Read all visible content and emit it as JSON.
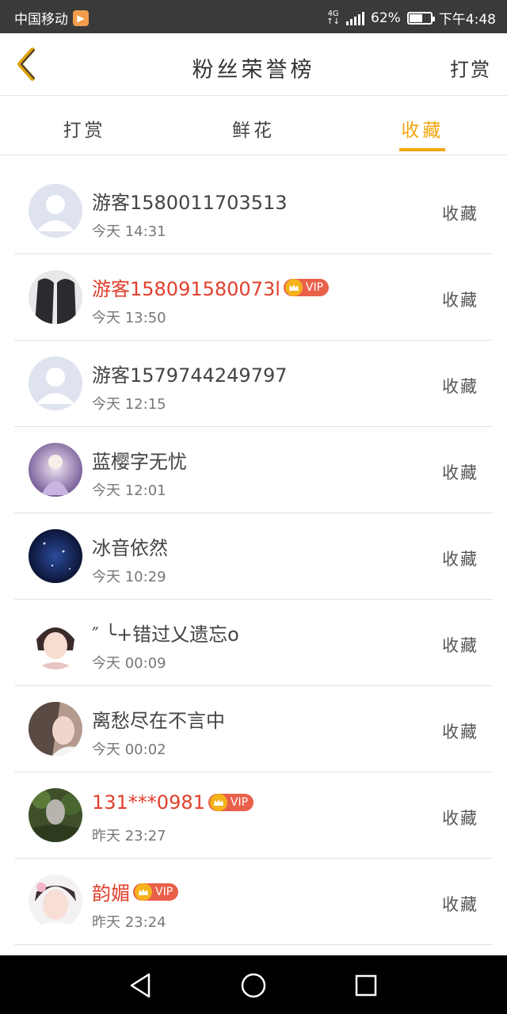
{
  "status_bar": {
    "carrier": "中国移动",
    "network": "4G",
    "battery": "62%",
    "battery_level": 0.62,
    "time": "下午4:48"
  },
  "header": {
    "title": "粉丝荣誉榜",
    "action": "打赏"
  },
  "tabs": [
    {
      "label": "打赏",
      "active": false
    },
    {
      "label": "鲜花",
      "active": false
    },
    {
      "label": "收藏",
      "active": true
    }
  ],
  "fans": [
    {
      "name": "游客1580011703513",
      "time": "今天 14:31",
      "action": "收藏",
      "vip": false
    },
    {
      "name": "游客158091580073l",
      "time": "今天 13:50",
      "action": "收藏",
      "vip": true,
      "vip_label": "VIP"
    },
    {
      "name": "游客1579744249797",
      "time": "今天 12:15",
      "action": "收藏",
      "vip": false
    },
    {
      "name": "蓝樱字无忧",
      "time": "今天 12:01",
      "action": "收藏",
      "vip": false
    },
    {
      "name": "冰音依然",
      "time": "今天 10:29",
      "action": "收藏",
      "vip": false
    },
    {
      "name": "″ ╰+错过乂遗忘o",
      "time": "今天 00:09",
      "action": "收藏",
      "vip": false
    },
    {
      "name": "离愁尽在不言中",
      "time": "今天 00:02",
      "action": "收藏",
      "vip": false
    },
    {
      "name": "131***0981",
      "time": "昨天 23:27",
      "action": "收藏",
      "vip": true,
      "vip_label": "VIP"
    },
    {
      "name": "韵媚",
      "time": "昨天 23:24",
      "action": "收藏",
      "vip": true,
      "vip_label": "VIP"
    }
  ],
  "colors": {
    "accent": "#f2a60d",
    "vip_name": "#e0402d",
    "vip_badge": "#e8604a",
    "status_bar": "#3a3a3a"
  }
}
